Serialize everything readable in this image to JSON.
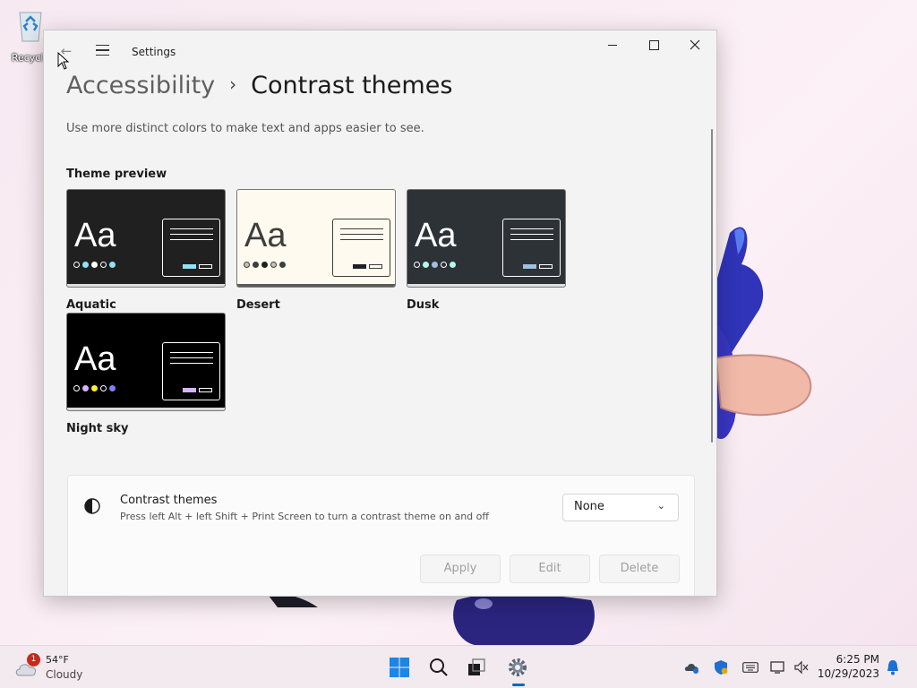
{
  "desktop": {
    "recycle_bin_label": "Recycle"
  },
  "window": {
    "title": "Settings",
    "breadcrumb": {
      "parent": "Accessibility",
      "separator": "›",
      "current": "Contrast themes"
    },
    "description": "Use more distinct colors to make text and apps easier to see.",
    "preview_label": "Theme preview",
    "themes": [
      {
        "name": "Aquatic",
        "aa": "Aa",
        "bg": "#202020",
        "fg": "#ffffff",
        "accent": "#8ee3f5",
        "dots": [
          "#202020",
          "#8ee3f5",
          "#ffffff",
          "#202020",
          "#8ee3f5"
        ]
      },
      {
        "name": "Desert",
        "aa": "Aa",
        "bg": "#fffaef",
        "fg": "#3d3d3d",
        "accent": "#202020",
        "dots": [
          "#c9c0b0",
          "#3d3d3d",
          "#202020",
          "#c9c0b0",
          "#3d3d3d"
        ]
      },
      {
        "name": "Dusk",
        "aa": "Aa",
        "bg": "#2d3236",
        "fg": "#ffffff",
        "accent": "#a1bfde",
        "dots": [
          "#2d3236",
          "#b6f6f0",
          "#a1bfde",
          "#2d3236",
          "#b6f6f0"
        ]
      },
      {
        "name": "Night sky",
        "aa": "Aa",
        "bg": "#000000",
        "fg": "#ffffff",
        "accent": "#d6b4fd",
        "dots": [
          "#000000",
          "#d6b4fd",
          "#ffee32",
          "#000000",
          "#8080ff"
        ]
      }
    ],
    "contrast_setting": {
      "title": "Contrast themes",
      "subtitle": "Press left Alt + left Shift + Print Screen to turn a contrast theme on and off",
      "selected": "None",
      "buttons": {
        "apply": "Apply",
        "edit": "Edit",
        "delete": "Delete"
      }
    }
  },
  "taskbar": {
    "weather": {
      "badge": "1",
      "temp": "54°F",
      "condition": "Cloudy"
    },
    "apps": [
      "start-icon",
      "search-icon",
      "task-view-icon",
      "settings-icon"
    ],
    "tray": [
      "onedrive-icon",
      "security-icon",
      "keyboard-icon",
      "network-icon",
      "volume-icon"
    ],
    "clock": {
      "time": "6:25 PM",
      "date": "10/29/2023"
    }
  },
  "colors": {
    "accent": "#0067c0",
    "window_bg": "#f3f3f3"
  }
}
